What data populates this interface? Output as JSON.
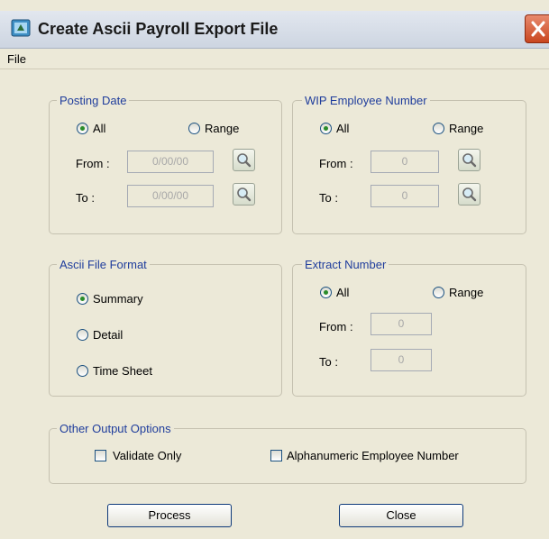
{
  "window": {
    "title": "Create Ascii Payroll Export File",
    "close_symbol": "×"
  },
  "menu": {
    "file": "File"
  },
  "posting_date": {
    "legend": "Posting Date",
    "all_label": "All",
    "range_label": "Range",
    "from_label": "From :",
    "to_label": "To :",
    "from_value": "0/00/00",
    "to_value": "0/00/00",
    "selected": "All"
  },
  "wip_employee": {
    "legend": "WIP Employee Number",
    "all_label": "All",
    "range_label": "Range",
    "from_label": "From :",
    "to_label": "To :",
    "from_value": "0",
    "to_value": "0",
    "selected": "All"
  },
  "file_format": {
    "legend": "Ascii File Format",
    "summary_label": "Summary",
    "detail_label": "Detail",
    "time_sheet_label": "Time Sheet",
    "selected": "Summary"
  },
  "extract_number": {
    "legend": "Extract Number",
    "all_label": "All",
    "range_label": "Range",
    "from_label": "From :",
    "to_label": "To :",
    "from_value": "0",
    "to_value": "0",
    "selected": "All"
  },
  "other_options": {
    "legend": "Other Output Options",
    "validate_only_label": "Validate Only",
    "validate_only_checked": false,
    "alphanumeric_label": "Alphanumeric Employee Number",
    "alphanumeric_checked": false
  },
  "buttons": {
    "process": "Process",
    "close": "Close"
  },
  "colors": {
    "dialog_background": "#ece9d8",
    "group_title": "#1f3d9c",
    "radio_selected": "#2a8c2a"
  }
}
